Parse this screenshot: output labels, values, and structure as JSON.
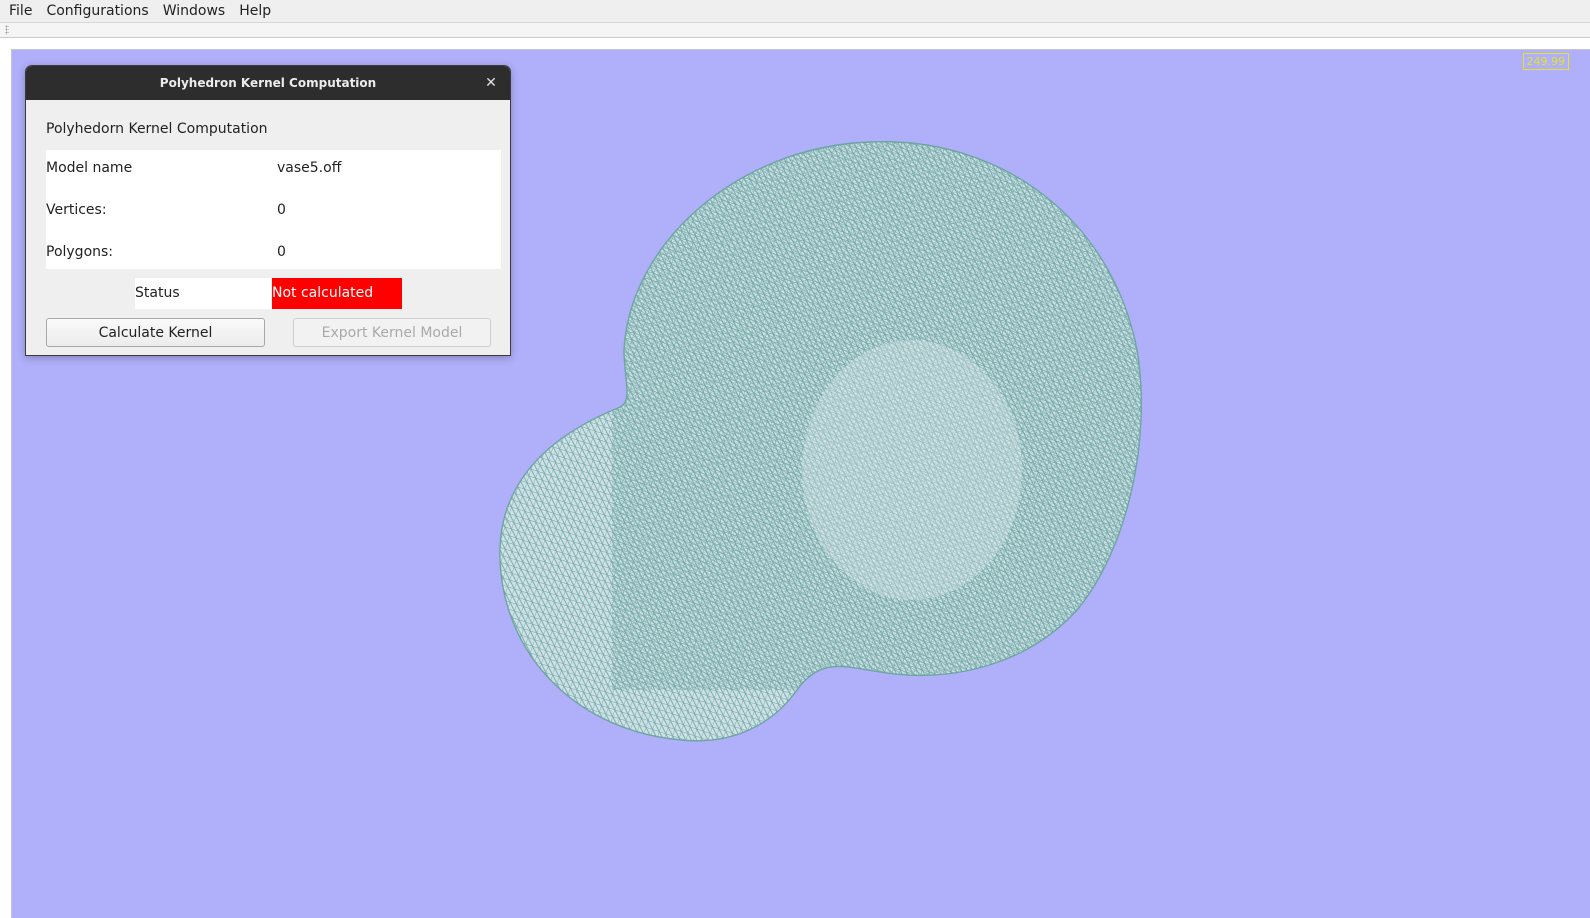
{
  "menubar": {
    "items": [
      "File",
      "Configurations",
      "Windows",
      "Help"
    ]
  },
  "viewport": {
    "background_color": "#afaffa",
    "fps": "249.99",
    "mesh_color": "#7fb8b4"
  },
  "dialog": {
    "title": "Polyhedron Kernel Computation",
    "heading": "Polyhedorn Kernel Computation",
    "close_icon": "close-icon",
    "rows": [
      {
        "label": "Model name",
        "value": "vase5.off"
      },
      {
        "label": "Vertices:",
        "value": "0"
      },
      {
        "label": "Polygons:",
        "value": "0"
      }
    ],
    "status_label": "Status",
    "status_value": "Not calculated",
    "status_color": "#ff0000",
    "calculate_button": "Calculate Kernel",
    "export_button": "Export Kernel Model"
  }
}
